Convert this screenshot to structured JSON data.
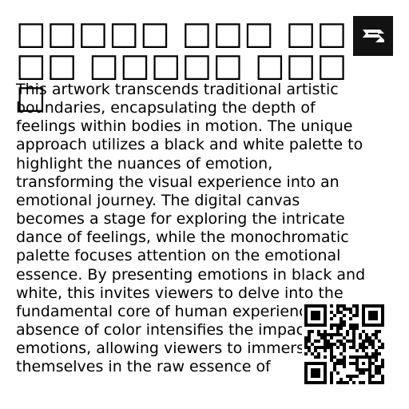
{
  "header": {
    "title": "□□□□□ □□□ □□□□ □□□□□ □□□□",
    "logo_icon": "brand-logo-icon",
    "logo_background": "#121212"
  },
  "content": {
    "description": "This artwork transcends traditional artistic boundaries, encapsulating the depth of feelings within bodies in motion. The unique approach utilizes a black and white palette to highlight the nuances of emotion, transforming the visual experience into an emotional journey. The digital canvas becomes a stage for exploring the intricate dance of feelings, while the monochromatic palette focuses attention on the emotional essence. By presenting emotions in black and white, this invites viewers to delve into the fundamental core of human experience. The absence of color intensifies the impact of emotions, allowing viewers to immerse themselves in the raw essence of"
  },
  "qr": {
    "icon": "qr-code-icon",
    "foreground": "#000000",
    "background": "#ffffff"
  }
}
